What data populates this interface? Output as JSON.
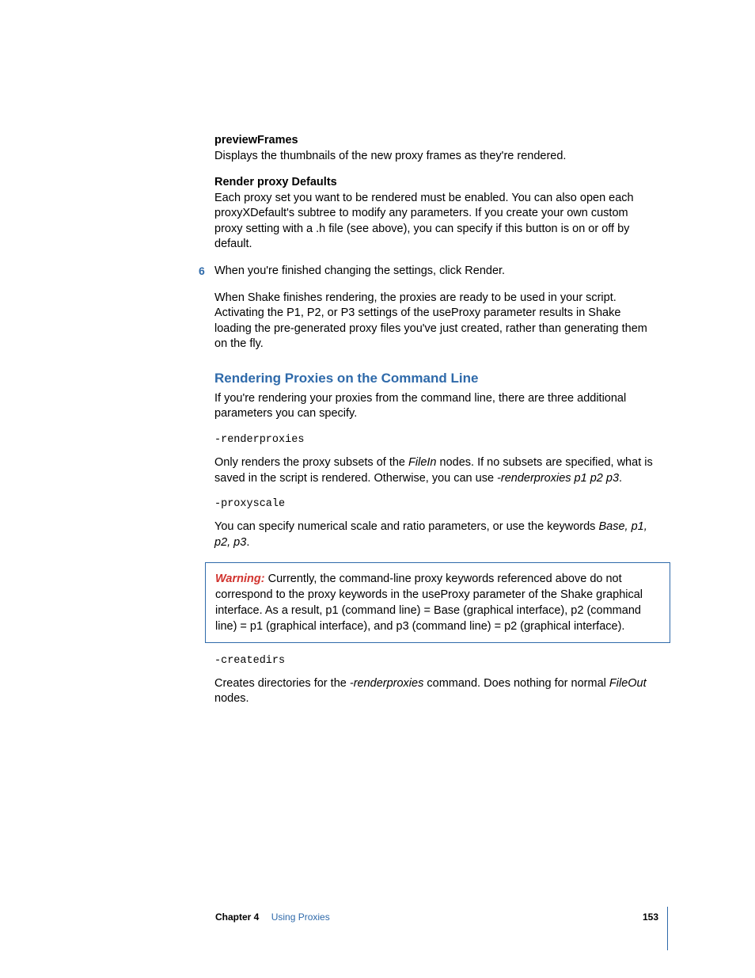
{
  "section1": {
    "heading": "previewFrames",
    "body": "Displays the thumbnails of the new proxy frames as they're rendered."
  },
  "section2": {
    "heading": "Render proxy Defaults",
    "body": "Each proxy set you want to be rendered must be enabled. You can also open each proxyXDefault's subtree to modify any parameters. If you create your own custom proxy setting with a .h file (see above), you can specify if this button is on or off by default."
  },
  "step6": {
    "num": "6",
    "line": "When you're finished changing the settings, click Render.",
    "body": "When Shake finishes rendering, the proxies are ready to be used in your script. Activating the P1, P2, or P3 settings of the useProxy parameter results in Shake loading the pre-generated proxy files you've just created, rather than generating them on the fly."
  },
  "h2": "Rendering Proxies on the Command Line",
  "intro": "If you're rendering your proxies from the command line, there are three additional parameters you can specify.",
  "cmd1": "-renderproxies",
  "cmd1_desc_a": "Only renders the proxy subsets of the ",
  "cmd1_desc_filein": "FileIn",
  "cmd1_desc_b": " nodes. If no subsets are specified, what is saved in the script is rendered. Otherwise, you can use ",
  "cmd1_desc_opt": "-renderproxies p1 p2 p3",
  "cmd1_desc_c": ".",
  "cmd2": "-proxyscale",
  "cmd2_desc_a": "You can specify numerical scale and ratio parameters, or use the keywords ",
  "cmd2_desc_kw": "Base, p1, p2, p3",
  "cmd2_desc_b": ".",
  "warning": {
    "label": "Warning:",
    "body": "  Currently, the command-line proxy keywords referenced above do not correspond to the proxy keywords in the useProxy parameter of the Shake graphical interface. As a result, p1 (command line) = Base (graphical interface), p2 (command line) = p1 (graphical interface), and p3 (command line) = p2 (graphical interface)."
  },
  "cmd3": "-createdirs",
  "cmd3_desc_a": "Creates directories for the ",
  "cmd3_desc_opt": "-renderproxies",
  "cmd3_desc_b": " command. Does nothing for normal ",
  "cmd3_desc_fileout": "FileOut",
  "cmd3_desc_c": " nodes.",
  "footer": {
    "chapter": "Chapter 4",
    "title": "Using Proxies",
    "page": "153"
  }
}
